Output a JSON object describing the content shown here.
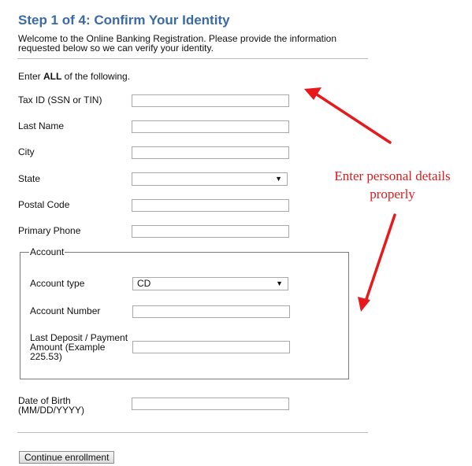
{
  "header": {
    "title": "Step 1 of 4: Confirm Your Identity",
    "intro": "Welcome to the Online Banking Registration. Please provide the information requested below so we can verify your identity."
  },
  "instructions": {
    "prefix": "Enter ",
    "bold": "ALL",
    "suffix": " of the following."
  },
  "fields": {
    "tax_id": {
      "label": "Tax ID (SSN or TIN)",
      "value": ""
    },
    "last_name": {
      "label": "Last Name",
      "value": ""
    },
    "city": {
      "label": "City",
      "value": ""
    },
    "state": {
      "label": "State",
      "selected": ""
    },
    "postal_code": {
      "label": "Postal Code",
      "value": ""
    },
    "primary_phone": {
      "label": "Primary Phone",
      "value": ""
    },
    "date_of_birth": {
      "label_line1": "Date of Birth",
      "label_line2": "(MM/DD/YYYY)",
      "value": ""
    }
  },
  "account": {
    "legend": "Account",
    "account_type": {
      "label": "Account type",
      "selected": "CD"
    },
    "account_number": {
      "label": "Account Number",
      "value": ""
    },
    "last_deposit": {
      "label_line1": "Last Deposit / Payment",
      "label_line2": "Amount (Example",
      "label_line3": "225.53)",
      "value": ""
    }
  },
  "actions": {
    "continue_label": "Continue enrollment"
  },
  "annotation": {
    "line1": "Enter personal details",
    "line2": "properly",
    "color": "#e8191b"
  },
  "icons": {
    "dropdown": "▼"
  }
}
